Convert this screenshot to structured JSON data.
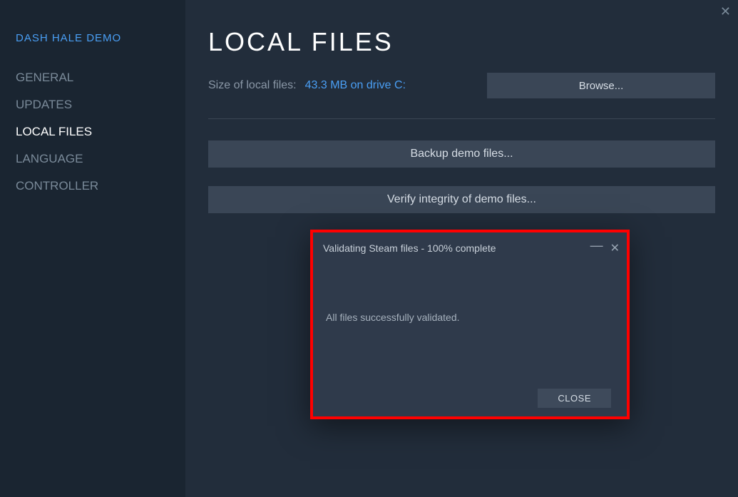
{
  "sidebar": {
    "title": "DASH HALE DEMO",
    "items": [
      {
        "label": "GENERAL"
      },
      {
        "label": "UPDATES"
      },
      {
        "label": "LOCAL FILES",
        "active": true
      },
      {
        "label": "LANGUAGE"
      },
      {
        "label": "CONTROLLER"
      }
    ]
  },
  "main": {
    "page_title": "LOCAL FILES",
    "size_label": "Size of local files:",
    "size_value": "43.3 MB on drive C:",
    "browse_label": "Browse...",
    "backup_label": "Backup demo files...",
    "verify_label": "Verify integrity of demo files..."
  },
  "dialog": {
    "title": "Validating Steam files - 100% complete",
    "message": "All files successfully validated.",
    "close_label": "CLOSE"
  }
}
